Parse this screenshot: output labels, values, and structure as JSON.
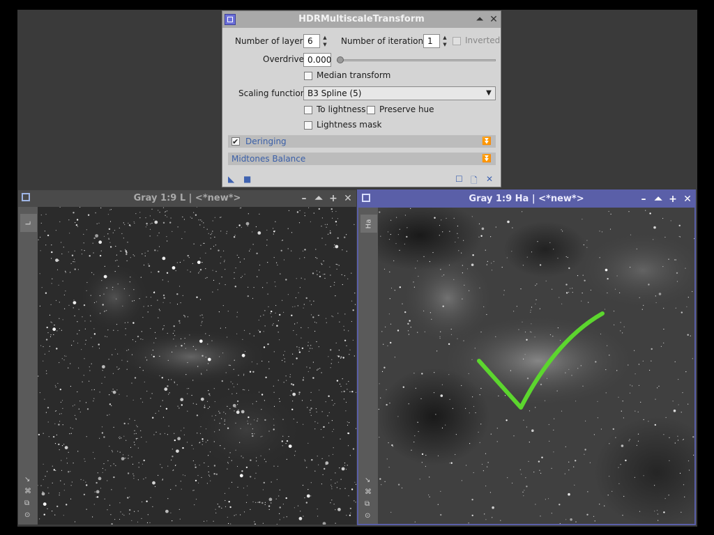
{
  "dialog": {
    "title": "HDRMultiscaleTransform",
    "number_of_layers_label": "Number of layers:",
    "number_of_layers_value": "6",
    "number_of_iterations_label": "Number of iterations:",
    "number_of_iterations_value": "1",
    "inverted_label": "Inverted",
    "overdrive_label": "Overdrive:",
    "overdrive_value": "0.000",
    "overdrive_slider_fraction": 0.0,
    "median_transform_label": "Median transform",
    "scaling_function_label": "Scaling function:",
    "scaling_function_value": "B3 Spline (5)",
    "to_lightness_label": "To lightness",
    "preserve_hue_label": "Preserve hue",
    "lightness_mask_label": "Lightness mask",
    "deringing_label": "Deringing",
    "deringing_checked": true,
    "midtones_balance_label": "Midtones Balance"
  },
  "windows": [
    {
      "title": "Gray 1:9 L | <*new*>",
      "tab_label": "L",
      "active": false
    },
    {
      "title": "Gray 1:9 Ha | <*new*>",
      "tab_label": "Ha",
      "active": true
    }
  ],
  "icons": {
    "shrink": "shade-icon",
    "close": "close-icon",
    "minimize": "minimize-icon",
    "maximize": "maximize-icon",
    "zoom": "plus-icon"
  },
  "colors": {
    "active_titlebar": "#5a5fa8",
    "inactive_titlebar": "#4a4a4a",
    "checkmark": "#5cd62e",
    "section_text": "#3a5fa8"
  }
}
